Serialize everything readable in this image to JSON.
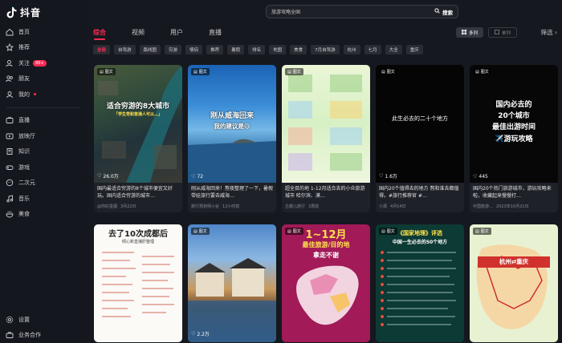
{
  "app": {
    "name": "抖音"
  },
  "sidebar": {
    "items": [
      {
        "label": "首页",
        "icon": "home-icon"
      },
      {
        "label": "推荐",
        "icon": "recommend-icon"
      },
      {
        "label": "关注",
        "icon": "follow-icon",
        "badge": "99+"
      },
      {
        "label": "朋友",
        "icon": "friends-icon"
      },
      {
        "label": "我的",
        "icon": "profile-icon",
        "dot": true
      },
      {
        "label": "直播",
        "icon": "live-icon"
      },
      {
        "label": "放映厅",
        "icon": "cinema-icon"
      },
      {
        "label": "知识",
        "icon": "knowledge-icon"
      },
      {
        "label": "游戏",
        "icon": "game-icon"
      },
      {
        "label": "二次元",
        "icon": "anime-icon"
      },
      {
        "label": "音乐",
        "icon": "music-icon"
      },
      {
        "label": "美食",
        "icon": "food-icon"
      }
    ],
    "bottom": [
      {
        "label": "设置",
        "icon": "settings-icon"
      },
      {
        "label": "业务合作",
        "icon": "business-icon"
      }
    ]
  },
  "search": {
    "value": "旅游攻略全国",
    "button": "搜索"
  },
  "tabs": [
    "综合",
    "视频",
    "用户",
    "直播"
  ],
  "view": {
    "list": "多列",
    "single": "单列",
    "filter": "筛选"
  },
  "chips": [
    "全部",
    "自驾游",
    "路线图",
    "穷游",
    "情侣",
    "推荐",
    "暑假",
    "排名",
    "地图",
    "美食",
    "7月自驾游",
    "杭州",
    "七月",
    "大全",
    "重庆"
  ],
  "tag_label": "图文",
  "cards": [
    {
      "likes": "26.0万",
      "title": "国内最适合穷游的8个城市便宜又好玩。国内适合穷游的城市…",
      "author": "@你好墨烟",
      "date": "3月22日",
      "overlay": "适合穷游的8大城市",
      "sub": "「学生党和普通人可以…」"
    },
    {
      "likes": "72",
      "title": "刚从威海回来！熬夜整理了一下，暑假 带娃旅行要去威海…",
      "author": "旅行规划师小谷",
      "date": "12小时前",
      "overlay": "刚从威海回来",
      "sub": "我的建议是😄"
    },
    {
      "likes": "",
      "title": "超全目的地 1-12月适合去的小众旅游城市 哈尔滨、漠…",
      "author": "古都儿旅行",
      "date": "3周前",
      "overlay": "",
      "sub": ""
    },
    {
      "likes": "1.6万",
      "title": "国内20个值得去的地方 熬和谁去都值得。#旅行推荐官 #…",
      "author": "小源",
      "date": "4月14日",
      "overlay": "此生必去的二十个地方",
      "sub": ""
    },
    {
      "likes": "445",
      "title": "国内20个热门旅游城市，游玩攻略来啦，收藏起来慢慢打…",
      "author": "中国旅游…",
      "date": "2023年10月21日",
      "overlay": "国内必去的",
      "sub": "20个城市"
    },
    {
      "likes": "",
      "title": "",
      "author": "",
      "date": "",
      "overlay": "去了10次成都后",
      "sub": "倾心新直播肝整理"
    },
    {
      "likes": "2.2万",
      "title": "",
      "author": "",
      "date": "",
      "overlay": "",
      "sub": ""
    },
    {
      "likes": "",
      "title": "",
      "author": "",
      "date": "",
      "overlay": "1~12月",
      "sub": "最佳旅游/目的地"
    },
    {
      "likes": "",
      "title": "",
      "author": "",
      "date": "",
      "overlay": "《国家地理》评选",
      "sub": "中国一生必去的50个地方"
    },
    {
      "likes": "",
      "title": "",
      "author": "",
      "date": "",
      "overlay": "杭州⇄重庆",
      "sub": ""
    }
  ],
  "card5_line3": "最佳出游时间",
  "card5_line4": "✈️游玩攻略",
  "card8_line3": "拿走不谢",
  "colors": {
    "accent": "#fe2c55",
    "bg": "#16181f"
  }
}
